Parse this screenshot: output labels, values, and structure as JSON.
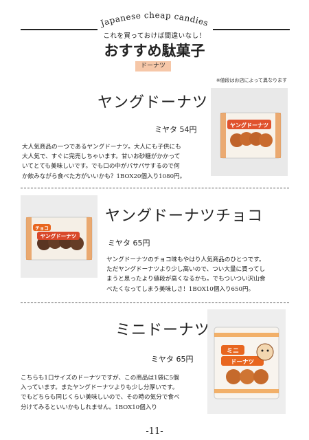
{
  "header": {
    "arc_title": "Japanese cheap candies",
    "subheading": "これを買っておけば間違いなし！",
    "title": "おすすめ駄菓子",
    "category": "ドーナツ",
    "price_note": "※値段はお店によって異なります"
  },
  "products": [
    {
      "name": "ヤングドーナツ",
      "price": "ミヤタ 54円",
      "description": [
        "大人気商品の一つであるヤングドーナツ。大人にも子供にも",
        "大人気で、すぐに完売しちゃいます。甘いお砂糖がかかって",
        "いてとても美味しいです。でも口の中がパサパサするので何",
        "か飲みながら食べた方がいいかも？1BOX20個入り1080円。"
      ],
      "package_text": "ヤングドーナツ",
      "package_color": "#e0522e"
    },
    {
      "name": "ヤングドーナツチョコ",
      "price": "ミヤタ 65円",
      "description": [
        "ヤングドーナツのチョコ味もやはり人気商品のひとつです。",
        "ただヤングドーナツより少し高いので、つい大量に買ってし",
        "まうと思ったより値段が高くなるかも。でもついつい沢山食",
        "べたくなってしまう美味しさ！1BOX10個入り650円。"
      ],
      "package_text": "ヤングドーナツ",
      "package_badge": "チョコ",
      "package_color": "#d9482a"
    },
    {
      "name": "ミニドーナツ",
      "price": "ミヤタ 65円",
      "description": [
        "こちらも1口サイズのドーナツですが、この商品は1袋に5個",
        "入っています。またヤングドーナツよりも少し分厚いです。",
        "でもどちらも同じくらい美味しいので、その時の気分で食べ",
        "分けてみるといいかもしれません。1BOX10個入り"
      ],
      "package_text": "ドーナツ",
      "package_badge": "ミニ",
      "package_color": "#e8661f"
    }
  ],
  "footer": {
    "page_number": "-11-"
  }
}
